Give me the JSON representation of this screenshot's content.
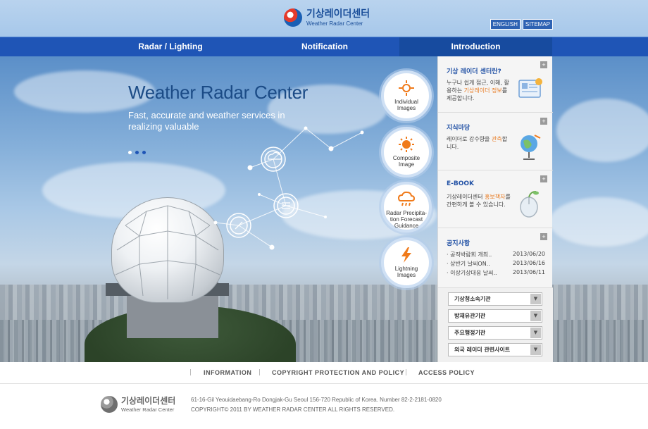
{
  "header": {
    "logo_ko": "기상레이더센터",
    "logo_en": "Weather Radar Center",
    "links": [
      "ENGLISH",
      "SITEMAP"
    ]
  },
  "nav": {
    "items": [
      {
        "label": "Radar / Lighting"
      },
      {
        "label": "Notification"
      },
      {
        "label": "Introduction",
        "active": true
      }
    ]
  },
  "hero": {
    "title": "Weather Radar Center",
    "subtitle": "Fast, accurate and weather services in realizing valuable"
  },
  "menu_circles": [
    {
      "label": "Individual Images",
      "icon": "sun-target-icon"
    },
    {
      "label": "Composite Image",
      "icon": "sun-icon"
    },
    {
      "label": "Radar Precipita- tion Forecast Guidance",
      "icon": "cloud-rain-icon"
    },
    {
      "label": "Lightning Images",
      "icon": "lightning-icon"
    }
  ],
  "panel": {
    "about": {
      "title": "기상 레이더 센터란?",
      "text_pre": "누구나 쉽게 접근, 이해, 활용하는 ",
      "text_hl": "기상레이더 정보",
      "text_post": "를 제공합니다."
    },
    "knowledge": {
      "title": "지식마당",
      "text_pre": "레이더로 강수량을 ",
      "text_hl": "관측",
      "text_post": "합니다."
    },
    "ebook": {
      "title": "E-BOOK",
      "text_pre": "기상레이더센터 ",
      "text_hl": "홍보책자",
      "text_post": "를 간편하게 볼 수 있습니다."
    },
    "notice": {
      "title": "공지사항",
      "items": [
        {
          "text": "· 공직박람회 개최..",
          "date": "2013/06/20"
        },
        {
          "text": "· 상반기 날씨ON..",
          "date": "2013/06/16"
        },
        {
          "text": "· 이상기상대응 날씨..",
          "date": "2013/06/11"
        }
      ]
    },
    "selects": [
      "기상청소속기관",
      "방재유관기관",
      "주요행정기관",
      "외국 레이더 관련사이트"
    ]
  },
  "footer": {
    "links": [
      "INFORMATION",
      "COPYRIGHT PROTECTION AND POLICY",
      "ACCESS POLICY"
    ],
    "logo_ko": "기상레이더센터",
    "logo_en": "Weather Radar Center",
    "address": "61-16-Gil Yeouidaebang-Ro Dongjak-Gu Seoul 156-720 Republic of Korea.  Number  82-2-2181-0820",
    "copyright": "COPYRIGHT© 2011 BY WEATHER RADAR CENTER ALL RIGHTS RESERVED."
  },
  "colors": {
    "nav_bg": "#1f55b6",
    "title_blue": "#1b4b86",
    "highlight_orange": "#e8781d"
  }
}
